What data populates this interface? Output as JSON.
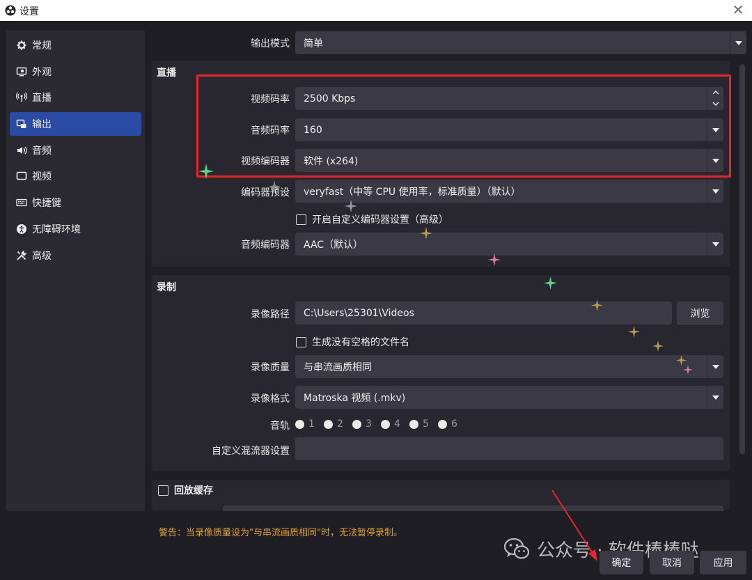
{
  "window": {
    "title": "设置",
    "close_icon": "close-icon"
  },
  "sidebar": {
    "items": [
      {
        "label": "常规",
        "icon": "gear-icon",
        "active": false
      },
      {
        "label": "外观",
        "icon": "appearance-icon",
        "active": false
      },
      {
        "label": "直播",
        "icon": "broadcast-icon",
        "active": false
      },
      {
        "label": "输出",
        "icon": "output-icon",
        "active": true
      },
      {
        "label": "音频",
        "icon": "speaker-icon",
        "active": false
      },
      {
        "label": "视频",
        "icon": "monitor-icon",
        "active": false
      },
      {
        "label": "快捷键",
        "icon": "keyboard-icon",
        "active": false
      },
      {
        "label": "无障碍环境",
        "icon": "accessibility-icon",
        "active": false
      },
      {
        "label": "高级",
        "icon": "tools-icon",
        "active": false
      }
    ]
  },
  "output_mode": {
    "label": "输出模式",
    "value": "简单"
  },
  "streaming": {
    "title": "直播",
    "video_bitrate": {
      "label": "视频码率",
      "value": "2500 Kbps"
    },
    "audio_bitrate": {
      "label": "音频码率",
      "value": "160"
    },
    "video_encoder": {
      "label": "视频编码器",
      "value": "软件 (x264)"
    },
    "encoder_preset": {
      "label": "编码器预设",
      "value": "veryfast（中等 CPU 使用率，标准质量）（默认）"
    },
    "advanced_checkbox": {
      "label": "开启自定义编码器设置（高级）",
      "checked": false
    },
    "audio_encoder": {
      "label": "音频编码器",
      "value": "AAC（默认）"
    }
  },
  "recording": {
    "title": "录制",
    "path": {
      "label": "录像路径",
      "value": "C:\\Users\\25301\\Videos",
      "browse": "浏览"
    },
    "no_space_checkbox": {
      "label": "生成没有空格的文件名",
      "checked": false
    },
    "quality": {
      "label": "录像质量",
      "value": "与串流画质相同"
    },
    "format": {
      "label": "录像格式",
      "value": "Matroska 视频 (.mkv)"
    },
    "tracks": {
      "label": "音轨",
      "items": [
        "1",
        "2",
        "3",
        "4",
        "5",
        "6"
      ]
    },
    "muxer": {
      "label": "自定义混流器设置",
      "value": ""
    }
  },
  "replay_buffer": {
    "label": "回放缓存",
    "checked": false
  },
  "warning": "警告：当录像质量设为\"与串流画质相同\"时，无法暂停录制。",
  "watermark": {
    "text": "公众号 · 软件棒棒哒",
    "icon": "wechat-icon"
  },
  "buttons": {
    "ok": "确定",
    "cancel": "取消",
    "apply": "应用"
  },
  "colors": {
    "accent": "#2a4aa3",
    "highlight_box": "#e8262a",
    "warning": "#e0a12b",
    "annotation_arrow": "#e8262a"
  }
}
